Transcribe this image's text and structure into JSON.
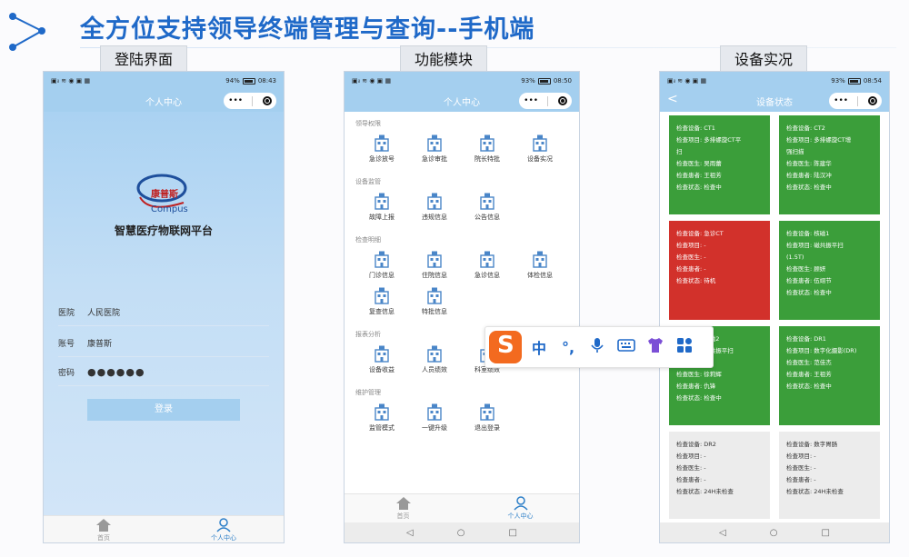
{
  "slide": {
    "title": "全方位支持领导终端管理与查询--手机端",
    "sections": [
      "登陆界面",
      "功能模块",
      "设备实况"
    ]
  },
  "status_bar": {
    "left": "▣ᵢₗ ≋ ◉ ▣ ▦",
    "phones": [
      {
        "right_pct": "94%",
        "time": "08:43"
      },
      {
        "right_pct": "93%",
        "time": "08:50"
      },
      {
        "right_pct": "93%",
        "time": "08:54"
      }
    ]
  },
  "login": {
    "nav_title": "个人中心",
    "brand_cn": "康普斯",
    "brand_en": "Compus",
    "platform": "智慧医疗物联网平台",
    "fields": [
      {
        "label": "医院",
        "value": "人民医院"
      },
      {
        "label": "账号",
        "value": "康普斯"
      },
      {
        "label": "密码",
        "value": "●●●●●●"
      }
    ],
    "login_button": "登录"
  },
  "tabs": {
    "home": "首页",
    "personal": "个人中心"
  },
  "modules": {
    "nav_title": "个人中心",
    "groups": [
      {
        "title": "领导权限",
        "items": [
          "急诊放号",
          "急诊审批",
          "院长特批",
          "设备实况"
        ]
      },
      {
        "title": "设备监管",
        "items": [
          "故障上报",
          "违规信息",
          "公告信息"
        ]
      },
      {
        "title": "检查明细",
        "items": [
          "门诊信息",
          "住院信息",
          "急诊信息",
          "体检信息",
          "复查信息",
          "特批信息"
        ]
      },
      {
        "title": "报表分析",
        "items": [
          "设备收益",
          "人员绩效",
          "科室绩效"
        ]
      },
      {
        "title": "维护管理",
        "items": [
          "监管模式",
          "一键升级",
          "退出登录"
        ]
      }
    ],
    "android_nav": {
      "back": "◁",
      "home": "○",
      "recent": "□"
    }
  },
  "device_status": {
    "nav_title": "设备状态",
    "back": "<",
    "cards": [
      {
        "color": "green",
        "lines": [
          "检查设备: CT1",
          "检查项目: 多排螺旋CT平",
          "扫",
          "检查医生: 吴雨蕾",
          "检查患者: 王祖芳",
          "检查状态: 检查中"
        ]
      },
      {
        "color": "green",
        "lines": [
          "检查设备: CT2",
          "检查项目: 多排螺旋CT增",
          "强扫描",
          "检查医生: 陈建华",
          "检查患者: 陆汉冲",
          "检查状态: 检查中"
        ]
      },
      {
        "color": "red",
        "lines": [
          "检查设备: 急诊CT",
          "检查项目: -",
          "检查医生: -",
          "检查患者: -",
          "检查状态: 待机"
        ]
      },
      {
        "color": "green",
        "lines": [
          "检查设备: 核磁1",
          "检查项目: 磁共振平扫",
          "(1.5T)",
          "检查医生: 顾妍",
          "检查患者: 伍翊节",
          "检查状态: 检查中"
        ]
      },
      {
        "color": "green",
        "lines": [
          "检查设备: 核磁2",
          "检查项目: 磁共振平扫",
          "",
          "检查医生: 徐莉辉",
          "检查患者: 仇锋",
          "检查状态: 检查中"
        ]
      },
      {
        "color": "green",
        "lines": [
          "检查设备: DR1",
          "检查项目: 数字化摄影(DR)",
          "检查医生: 范佳杰",
          "检查患者: 王祖芳",
          "检查状态: 检查中"
        ]
      },
      {
        "color": "grey",
        "lines": [
          "检查设备: DR2",
          "检查项目: -",
          "检查医生: -",
          "检查患者: -",
          "检查状态: 24H未检查"
        ]
      },
      {
        "color": "grey",
        "lines": [
          "检查设备: 数字胃肠",
          "检查项目: -",
          "检查医生: -",
          "检查患者: -",
          "检查状态: 24H未检查"
        ]
      }
    ]
  },
  "ime": {
    "logo": "S",
    "zh": "中",
    "punct": "°,"
  },
  "colors": {
    "accent": "#1f69c8",
    "nav": "#a4cfef",
    "green": "#3b9e3a",
    "red": "#d2312b",
    "grey": "#ececec",
    "ime_orange": "#f36a1f"
  }
}
